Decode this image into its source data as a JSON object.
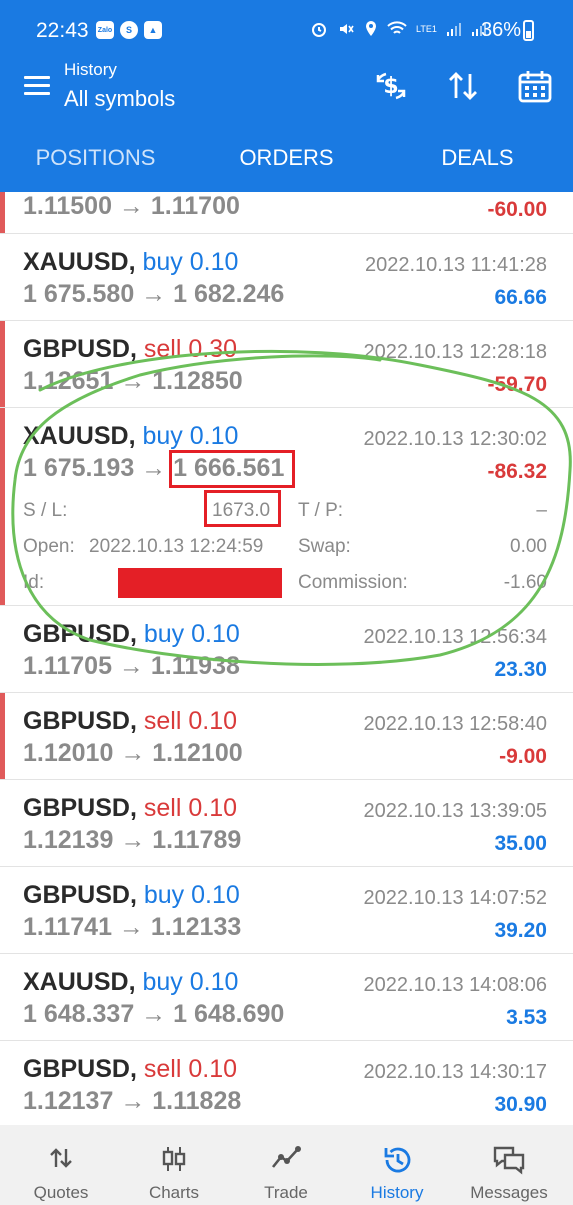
{
  "status_bar": {
    "time": "22:43",
    "battery": "36%",
    "app_badges": [
      "Zalo",
      "S"
    ],
    "network": "LTE1"
  },
  "header": {
    "subtitle": "History",
    "title": "All symbols"
  },
  "tabs": [
    {
      "label": "POSITIONS"
    },
    {
      "label": "ORDERS"
    },
    {
      "label": "DEALS"
    }
  ],
  "trades": [
    {
      "symbol": "",
      "side": "",
      "volume": "",
      "time": "",
      "prices": "1.11500 → 1.11700",
      "profit": "-60.00",
      "loss": true,
      "partial": true
    },
    {
      "symbol": "XAUUSD",
      "side": "buy",
      "volume": "0.10",
      "time": "2022.10.13 11:41:28",
      "prices": "1 675.580 → 1 682.246",
      "profit": "66.66",
      "loss": false
    },
    {
      "symbol": "GBPUSD",
      "side": "sell",
      "volume": "0.30",
      "time": "2022.10.13 12:28:18",
      "prices": "1.12651 → 1.12850",
      "profit": "-59.70",
      "loss": true
    },
    {
      "symbol": "XAUUSD",
      "side": "buy",
      "volume": "0.10",
      "time": "2022.10.13 12:30:02",
      "open_price": "1 675.193",
      "close_price": "1 666.561",
      "profit": "-86.32",
      "loss": true,
      "expanded": true,
      "details": {
        "sl_label": "S / L:",
        "sl": "1673.0",
        "tp_label": "T / P:",
        "tp": "–",
        "open_label": "Open:",
        "open": "2022.10.13 12:24:59",
        "swap_label": "Swap:",
        "swap": "0.00",
        "id_label": "Id:",
        "commission_label": "Commission:",
        "commission": "-1.60"
      }
    },
    {
      "symbol": "GBPUSD",
      "side": "buy",
      "volume": "0.10",
      "time": "2022.10.13 12:56:34",
      "prices": "1.11705 → 1.11938",
      "profit": "23.30",
      "loss": false
    },
    {
      "symbol": "GBPUSD",
      "side": "sell",
      "volume": "0.10",
      "time": "2022.10.13 12:58:40",
      "prices": "1.12010 → 1.12100",
      "profit": "-9.00",
      "loss": true
    },
    {
      "symbol": "GBPUSD",
      "side": "sell",
      "volume": "0.10",
      "time": "2022.10.13 13:39:05",
      "prices": "1.12139 → 1.11789",
      "profit": "35.00",
      "loss": false
    },
    {
      "symbol": "GBPUSD",
      "side": "buy",
      "volume": "0.10",
      "time": "2022.10.13 14:07:52",
      "prices": "1.11741 → 1.12133",
      "profit": "39.20",
      "loss": false
    },
    {
      "symbol": "XAUUSD",
      "side": "buy",
      "volume": "0.10",
      "time": "2022.10.13 14:08:06",
      "prices": "1 648.337 → 1 648.690",
      "profit": "3.53",
      "loss": false
    },
    {
      "symbol": "GBPUSD",
      "side": "sell",
      "volume": "0.10",
      "time": "2022.10.13 14:30:17",
      "prices": "1.12137 → 1.11828",
      "profit": "30.90",
      "loss": false
    }
  ],
  "bottom_nav": [
    {
      "label": "Quotes",
      "icon": "quotes-icon"
    },
    {
      "label": "Charts",
      "icon": "charts-icon"
    },
    {
      "label": "Trade",
      "icon": "trade-icon"
    },
    {
      "label": "History",
      "icon": "history-icon",
      "active": true
    },
    {
      "label": "Messages",
      "icon": "messages-icon"
    }
  ],
  "colors": {
    "header": "#1a7ae2",
    "profit": "#1a7ae2",
    "loss": "#d93a3a",
    "annotation_box": "#e41f26",
    "annotation_circle": "#6cbf5a"
  }
}
